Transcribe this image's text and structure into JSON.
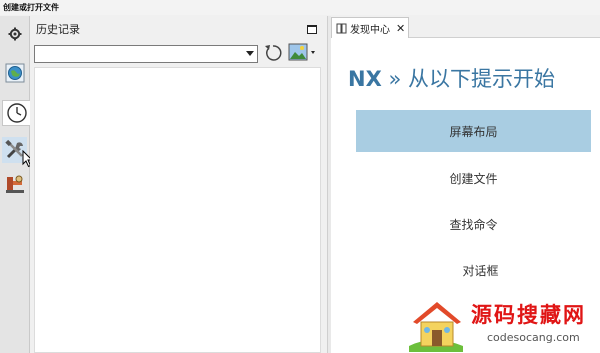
{
  "app_title": "创建或打开文件",
  "resource_bar": {
    "items": [
      {
        "icon": "gear-icon"
      },
      {
        "icon": "globe-icon"
      },
      {
        "icon": "clock-icon",
        "active": true
      },
      {
        "icon": "tools-icon"
      },
      {
        "icon": "machine-icon"
      }
    ]
  },
  "history_panel": {
    "title": "历史记录",
    "select_value": ""
  },
  "discovery": {
    "tab_label": "发现中心",
    "heading_prefix": "NX",
    "heading_sep": " » ",
    "heading_text": "从以下提示开始",
    "items": [
      {
        "label": "屏幕布局",
        "selected": true
      },
      {
        "label": "创建文件",
        "selected": false
      },
      {
        "label": "查找命令",
        "selected": false
      },
      {
        "label": "对话框",
        "selected": false
      }
    ]
  },
  "watermark": {
    "cn": "源码搜藏网",
    "url": "codesocang.com"
  },
  "colors": {
    "accent": "#3a76a2",
    "selected_bg": "#a9cde2",
    "watermark_red": "#e01515"
  }
}
